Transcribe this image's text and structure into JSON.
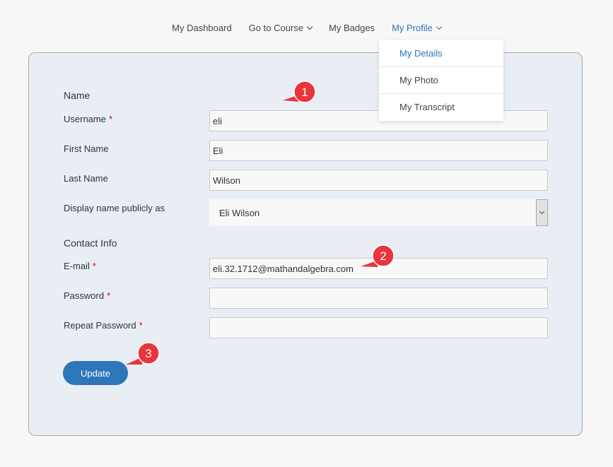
{
  "nav": {
    "items": [
      {
        "label": "My Dashboard",
        "has_caret": false,
        "active": false
      },
      {
        "label": "Go to Course",
        "has_caret": true,
        "active": false
      },
      {
        "label": "My Badges",
        "has_caret": false,
        "active": false
      },
      {
        "label": "My Profile",
        "has_caret": true,
        "active": true
      }
    ],
    "accent_color": "#2d76b8"
  },
  "dropdown": {
    "items": [
      {
        "label": "My Details",
        "active": true
      },
      {
        "label": "My Photo",
        "active": false
      },
      {
        "label": "My Transcript",
        "active": false
      }
    ]
  },
  "form": {
    "name_section": "Name",
    "contact_section": "Contact Info",
    "required_marker": "*",
    "username": {
      "label": "Username",
      "value": "eli",
      "required": true
    },
    "first_name": {
      "label": "First Name",
      "value": "Eli",
      "required": false
    },
    "last_name": {
      "label": "Last Name",
      "value": "Wilson",
      "required": false
    },
    "display_name": {
      "label": "Display name publicly as",
      "value": "Eli Wilson",
      "required": false
    },
    "email": {
      "label": "E-mail",
      "value": "eli.32.1712@mathandalgebra.com",
      "required": true
    },
    "password": {
      "label": "Password",
      "value": "",
      "required": true
    },
    "repeat_password": {
      "label": "Repeat Password",
      "value": "",
      "required": true
    },
    "update_label": "Update"
  },
  "callouts": {
    "one": "1",
    "two": "2",
    "three": "3",
    "color": "#e8343c"
  }
}
